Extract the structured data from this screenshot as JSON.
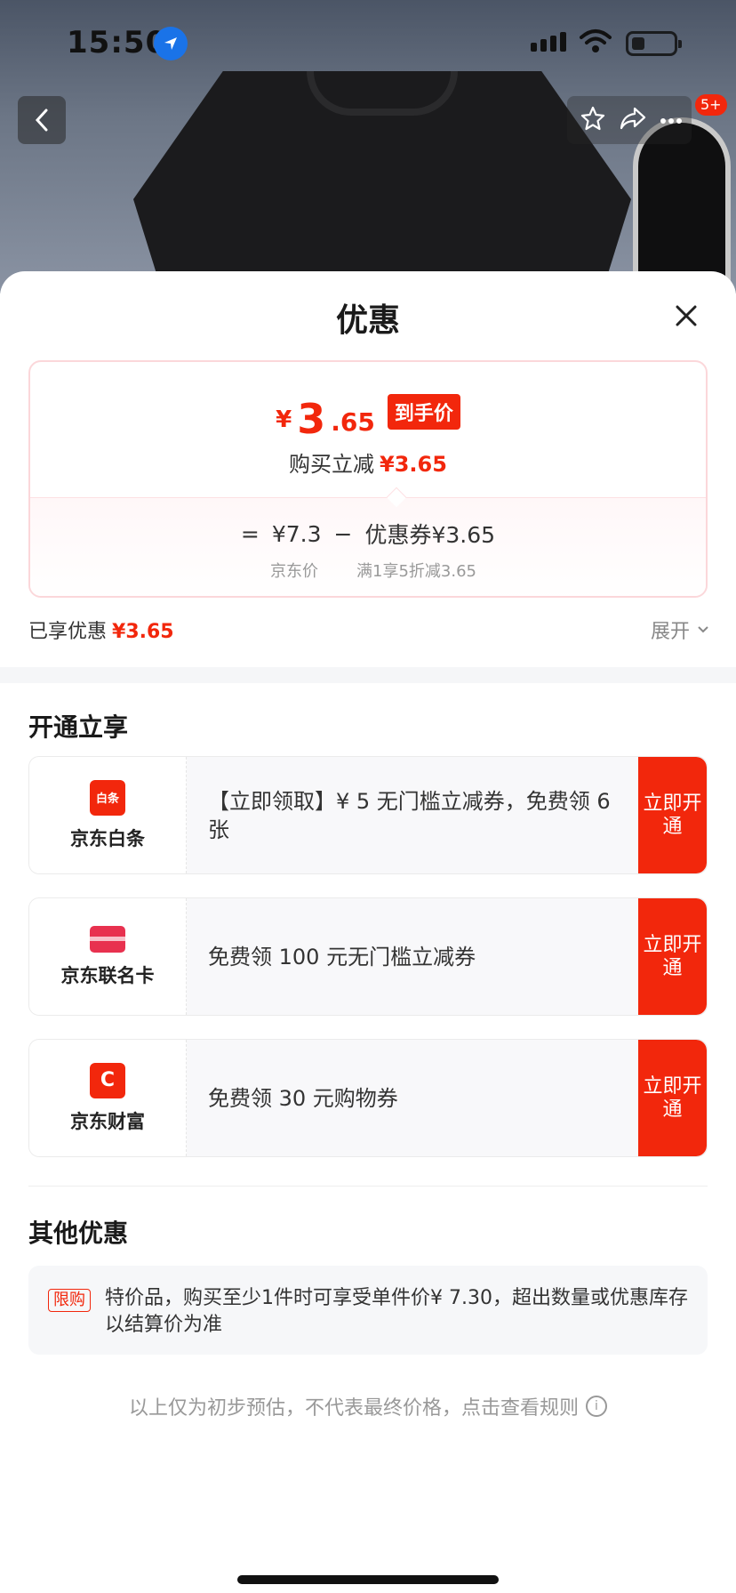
{
  "status_bar": {
    "time": "15:50"
  },
  "nav": {
    "cart_badge": "5+"
  },
  "sheet": {
    "title": "优惠",
    "price_card": {
      "currency": "¥",
      "price_int": "3",
      "price_dec": ".65",
      "hand_price_tag": "到手价",
      "reduce_label": "购买立减",
      "reduce_amount": "¥3.65",
      "calc": {
        "equals": "=",
        "jd_price": "¥7.3",
        "minus": "−",
        "coupon_label": "优惠券¥3.65",
        "jd_price_caption": "京东价",
        "coupon_caption": "满1享5折减3.65"
      }
    },
    "enjoyed": {
      "label": "已享优惠",
      "amount": "¥3.65"
    },
    "expand_label": "展开",
    "open_section": {
      "title": "开通立享",
      "offers": [
        {
          "name": "京东白条",
          "logo_text": "白条",
          "desc": "【立即领取】¥ 5 无门槛立减券，免费领 6 张",
          "button": "立即开通",
          "color": "#f2270c"
        },
        {
          "name": "京东联名卡",
          "logo_text": "",
          "desc": "免费领 100 元无门槛立减券",
          "button": "立即开通",
          "color": "#e8314f"
        },
        {
          "name": "京东财富",
          "logo_text": "C",
          "desc": "免费领 30 元购物券",
          "button": "立即开通",
          "color": "#f2270c"
        }
      ]
    },
    "other_section": {
      "title": "其他优惠",
      "limit_tag": "限购",
      "limit_text": "特价品，购买至少1件时可享受单件价¥ 7.30，超出数量或优惠库存以结算价为准"
    },
    "footer_note": "以上仅为初步预估，不代表最终价格，点击查看规则"
  },
  "colors": {
    "accent": "#f2270c"
  }
}
